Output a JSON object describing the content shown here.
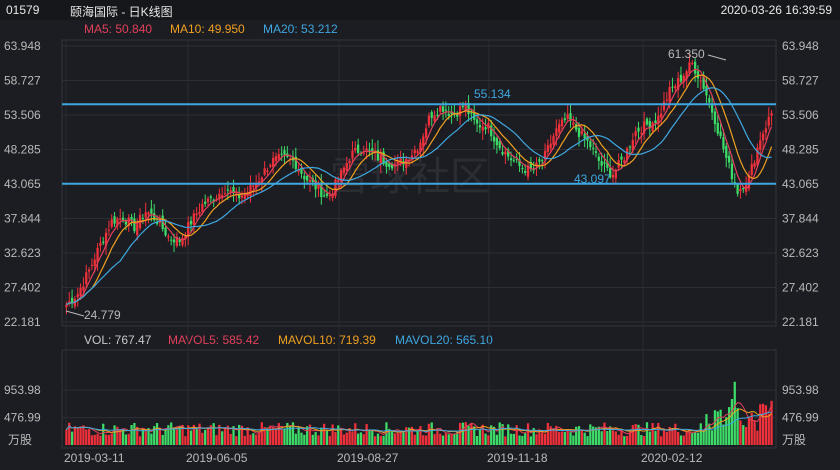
{
  "header": {
    "code": "01579",
    "name": "颐海国际 - 日K线图",
    "datetime": "2020-03-26 16:39:59"
  },
  "price_legend": [
    {
      "label": "MA5: 50.840",
      "color": "#e2405a"
    },
    {
      "label": "MA10: 49.950",
      "color": "#f0a020"
    },
    {
      "label": "MA20: 53.212",
      "color": "#3fa7e0"
    }
  ],
  "volume_legend": [
    {
      "label": "VOL: 767.47",
      "color": "#c8c8c8"
    },
    {
      "label": "MAVOL5: 585.42",
      "color": "#e2405a"
    },
    {
      "label": "MAVOL10: 719.39",
      "color": "#f0a020"
    },
    {
      "label": "MAVOL20: 565.10",
      "color": "#3fa7e0"
    }
  ],
  "watermark": "雪球社区",
  "volume_unit": "万股",
  "chart_data": [
    {
      "type": "candlestick",
      "y_ticks": [
        "63.948",
        "58.727",
        "53.506",
        "48.285",
        "43.065",
        "37.844",
        "32.623",
        "27.402",
        "22.181"
      ],
      "ylim": [
        22.181,
        63.948
      ],
      "x_labels": [
        "2019-03-11",
        "2019-06-05",
        "2019-08-27",
        "2019-11-18",
        "2020-02-12"
      ],
      "annotations": [
        {
          "text": "61.350",
          "kind": "high"
        },
        {
          "text": "55.134",
          "kind": "level"
        },
        {
          "text": "43.097",
          "kind": "level"
        },
        {
          "text": "24.779",
          "kind": "low"
        }
      ],
      "horizontal_lines": [
        55.134,
        43.097
      ],
      "anchors": [
        24.8,
        26.5,
        30,
        34,
        37.5,
        38,
        36.5,
        39,
        37.5,
        35,
        34.5,
        37.5,
        40,
        41,
        42.5,
        41,
        42,
        44,
        46.5,
        47,
        46.5,
        44,
        42.5,
        41,
        44,
        47.5,
        48.5,
        47.5,
        46.5,
        46,
        47,
        49,
        53.5,
        54.8,
        53.5,
        55,
        52,
        52,
        49,
        47,
        45.5,
        45,
        47,
        51,
        53,
        51,
        49,
        46,
        44.5,
        47,
        51,
        52,
        53,
        57,
        59,
        61.35,
        58,
        53,
        47,
        42,
        44,
        50,
        53.8
      ],
      "up_color": "#f0303a",
      "down_color": "#3ddb68"
    },
    {
      "type": "bar",
      "name": "VOL",
      "y_ticks": [
        "953.98",
        "476.99"
      ],
      "ylim": [
        0,
        1200
      ],
      "last_value": 767.47
    }
  ]
}
